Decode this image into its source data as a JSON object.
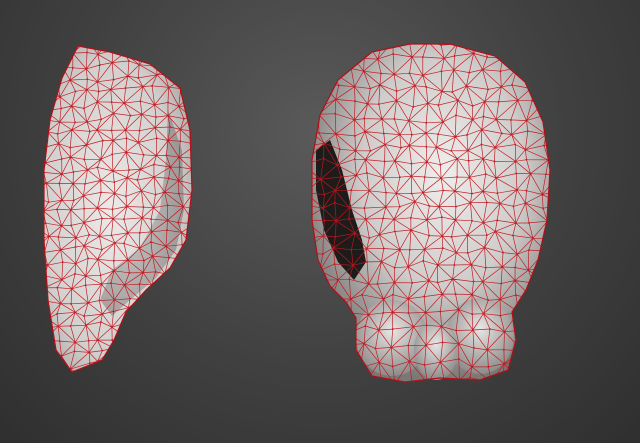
{
  "viewport": {
    "background_top": "#5a5a5a",
    "background_bottom": "#2f2f2f"
  },
  "colors": {
    "surface_light": "#e6e4e2",
    "surface_mid": "#b8b6b4",
    "surface_dark": "#6e6c6a",
    "cavity": "#1e1c1b",
    "wire": "#c0161e"
  },
  "objects": [
    {
      "name": "side-view-mesh",
      "icon": "skull-side-mesh-icon"
    },
    {
      "name": "front-view-mesh",
      "icon": "skull-front-mesh-icon"
    }
  ]
}
